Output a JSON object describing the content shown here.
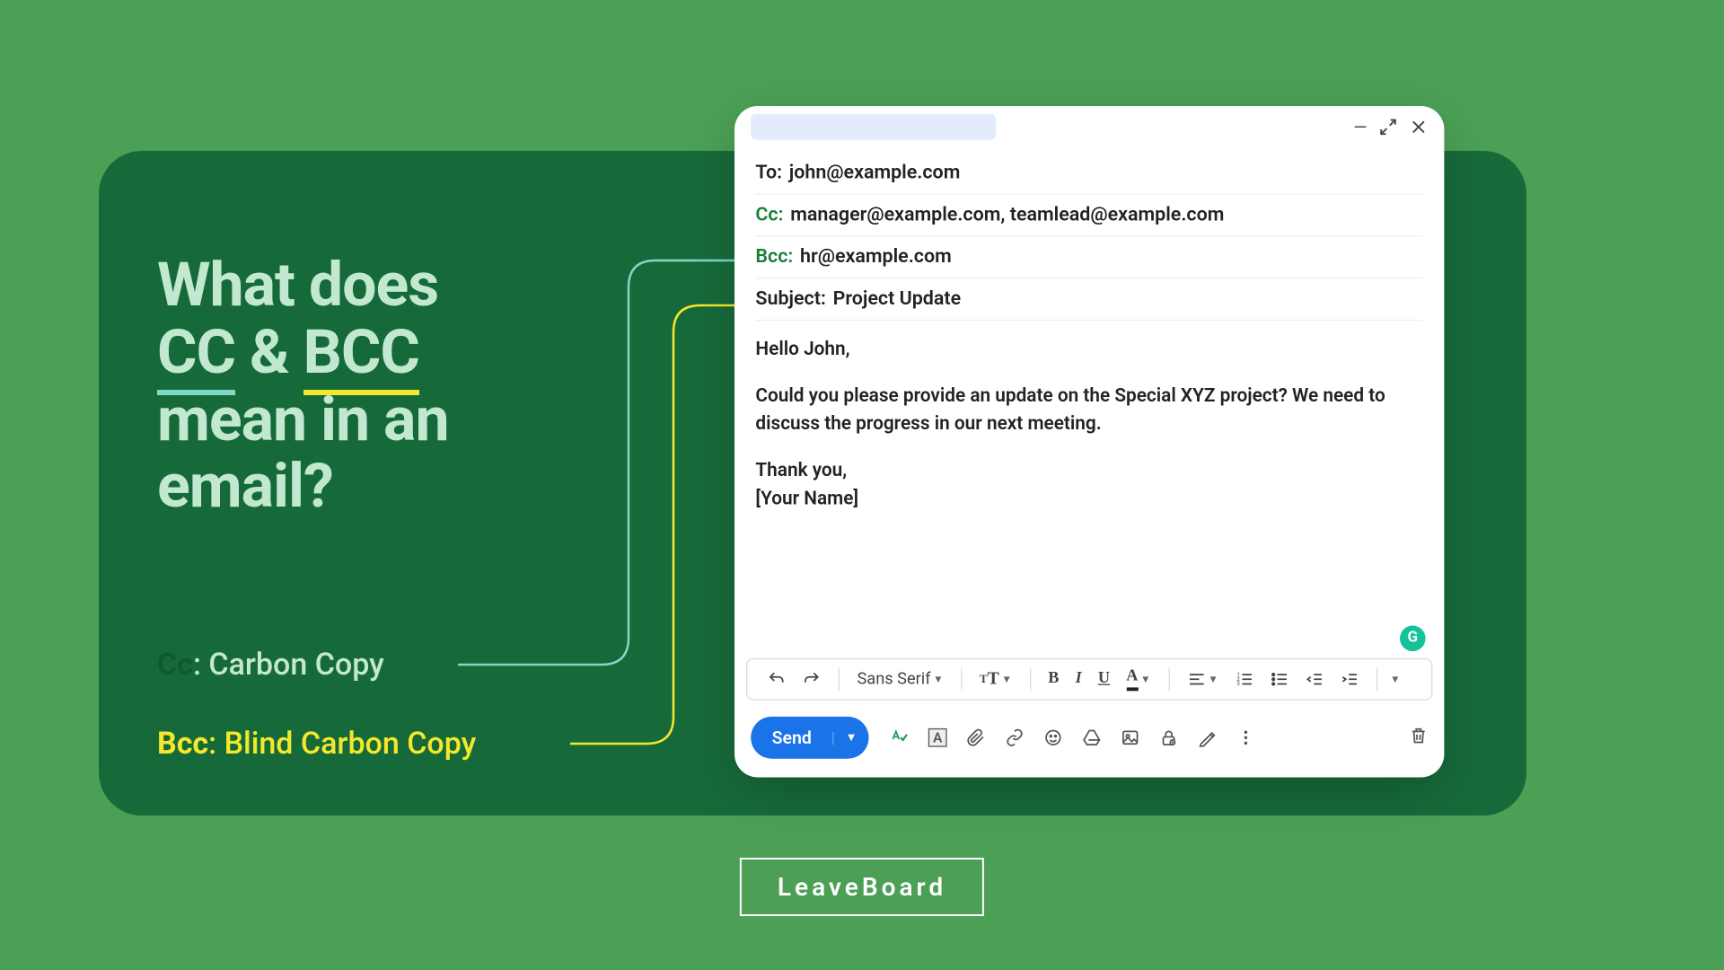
{
  "headline": {
    "line1": "What does",
    "cc": "CC",
    "amp": " & ",
    "bcc": "BCC",
    "line3": "mean in an",
    "line4": "email?"
  },
  "legend": {
    "cc_label": "Cc",
    "cc_def": "Carbon Copy",
    "bcc_label": "Bcc",
    "bcc_def": "Blind Carbon Copy"
  },
  "brand": "LeaveBoard",
  "compose": {
    "to_label": "To:",
    "to_value": "john@example.com",
    "cc_label": "Cc:",
    "cc_value": "manager@example.com, teamlead@example.com",
    "bcc_label": "Bcc:",
    "bcc_value": "hr@example.com",
    "subject_label": "Subject:",
    "subject_value": "Project Update",
    "greeting": "Hello John,",
    "body": "Could you please provide an update on the Special XYZ project? We need to discuss the progress in our next meeting.",
    "thanks": "Thank you,",
    "signature": "[Your Name]"
  },
  "toolbar": {
    "font": "Sans Serif",
    "send": "Send"
  }
}
